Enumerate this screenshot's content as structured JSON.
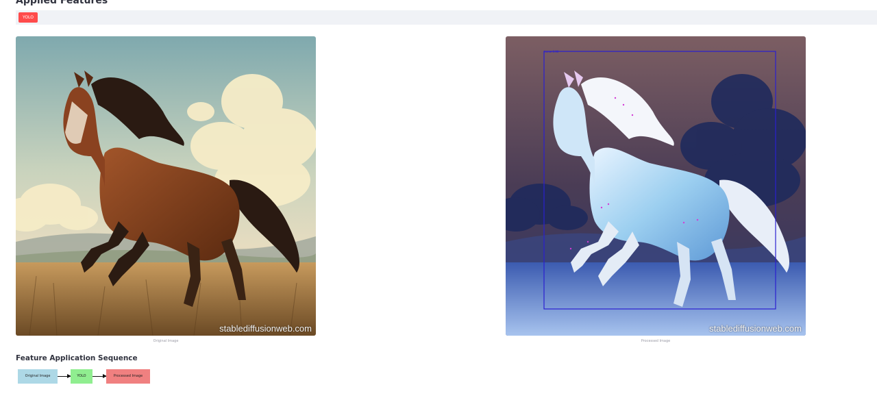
{
  "header": {
    "title": "Applied Features"
  },
  "features": [
    "YOLO"
  ],
  "images": {
    "original": {
      "caption": "Original Image",
      "watermark": "stablediffusionweb.com"
    },
    "processed": {
      "caption": "Processed Image",
      "watermark": "stablediffusionweb.com",
      "detection_label": "horse 0.90"
    }
  },
  "sequence": {
    "title": "Feature Application Sequence",
    "steps": [
      "Original Image",
      "YOLO",
      "Processed Image"
    ],
    "colors": [
      "#add8e6",
      "#90ee90",
      "#f08080"
    ]
  }
}
